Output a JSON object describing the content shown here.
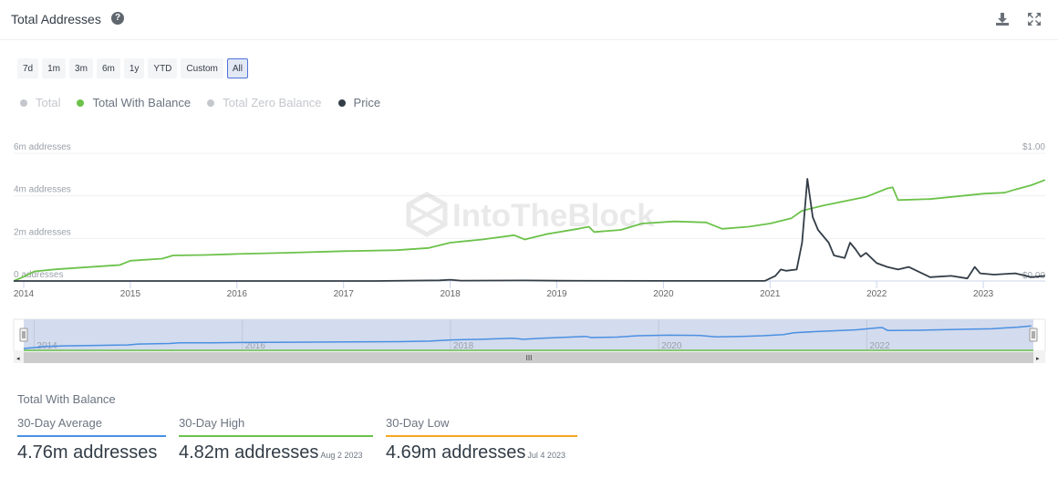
{
  "header": {
    "title": "Total Addresses",
    "help_icon": "question-circle-icon",
    "download_icon": "download-icon",
    "fullscreen_icon": "expand-icon"
  },
  "range_buttons": [
    {
      "label": "7d",
      "active": false
    },
    {
      "label": "1m",
      "active": false
    },
    {
      "label": "3m",
      "active": false
    },
    {
      "label": "6m",
      "active": false
    },
    {
      "label": "1y",
      "active": false
    },
    {
      "label": "YTD",
      "active": false
    },
    {
      "label": "Custom",
      "active": false
    },
    {
      "label": "All",
      "active": true
    }
  ],
  "legend": [
    {
      "label": "Total",
      "color": "#c4c7cc",
      "enabled": false
    },
    {
      "label": "Total With Balance",
      "color": "#6cc24a",
      "enabled": true
    },
    {
      "label": "Total Zero Balance",
      "color": "#c4c7cc",
      "enabled": false
    },
    {
      "label": "Price",
      "color": "#333d47",
      "enabled": true
    }
  ],
  "watermark": "IntoTheBlock",
  "chart_data": {
    "type": "line",
    "title": "Total Addresses",
    "xlabel": "",
    "ylabel": "addresses",
    "x_ticks": [
      "2014",
      "2015",
      "2016",
      "2017",
      "2018",
      "2019",
      "2020",
      "2021",
      "2022",
      "2023"
    ],
    "y_left_ticks": [
      "0 addresses",
      "2m addresses",
      "4m addresses",
      "6m addresses"
    ],
    "y_left_range": [
      0,
      6000000
    ],
    "y_right_ticks": [
      "$0.00",
      "$1.00"
    ],
    "y_right_range": [
      0,
      1.0
    ],
    "grid": true,
    "series": [
      {
        "name": "Total With Balance",
        "color": "#6cc24a",
        "axis": "left",
        "points": [
          [
            2013.9,
            0.0
          ],
          [
            2014.0,
            0.2
          ],
          [
            2014.1,
            0.45
          ],
          [
            2014.3,
            0.55
          ],
          [
            2014.6,
            0.65
          ],
          [
            2014.9,
            0.75
          ],
          [
            2015.0,
            0.95
          ],
          [
            2015.3,
            1.05
          ],
          [
            2015.4,
            1.2
          ],
          [
            2015.7,
            1.22
          ],
          [
            2016.0,
            1.27
          ],
          [
            2016.5,
            1.33
          ],
          [
            2017.0,
            1.4
          ],
          [
            2017.5,
            1.45
          ],
          [
            2017.8,
            1.55
          ],
          [
            2018.0,
            1.8
          ],
          [
            2018.3,
            1.95
          ],
          [
            2018.6,
            2.15
          ],
          [
            2018.7,
            1.95
          ],
          [
            2018.9,
            2.2
          ],
          [
            2019.2,
            2.45
          ],
          [
            2019.3,
            2.55
          ],
          [
            2019.35,
            2.3
          ],
          [
            2019.6,
            2.4
          ],
          [
            2019.8,
            2.7
          ],
          [
            2020.1,
            2.8
          ],
          [
            2020.4,
            2.75
          ],
          [
            2020.55,
            2.45
          ],
          [
            2020.8,
            2.55
          ],
          [
            2021.0,
            2.7
          ],
          [
            2021.2,
            2.95
          ],
          [
            2021.3,
            3.3
          ],
          [
            2021.5,
            3.55
          ],
          [
            2021.7,
            3.75
          ],
          [
            2021.9,
            3.95
          ],
          [
            2022.1,
            4.35
          ],
          [
            2022.15,
            4.4
          ],
          [
            2022.2,
            3.8
          ],
          [
            2022.5,
            3.85
          ],
          [
            2022.8,
            4.0
          ],
          [
            2023.0,
            4.1
          ],
          [
            2023.2,
            4.15
          ],
          [
            2023.3,
            4.3
          ],
          [
            2023.45,
            4.5
          ],
          [
            2023.58,
            4.75
          ]
        ]
      },
      {
        "name": "Price",
        "color": "#333d47",
        "axis": "right",
        "points": [
          [
            2013.9,
            0.0
          ],
          [
            2017.3,
            0.0
          ],
          [
            2017.9,
            0.005
          ],
          [
            2018.0,
            0.01
          ],
          [
            2018.1,
            0.003
          ],
          [
            2018.7,
            0.004
          ],
          [
            2019.0,
            0.002
          ],
          [
            2020.0,
            0.001
          ],
          [
            2020.95,
            0.001
          ],
          [
            2021.05,
            0.04
          ],
          [
            2021.1,
            0.09
          ],
          [
            2021.15,
            0.08
          ],
          [
            2021.25,
            0.09
          ],
          [
            2021.3,
            0.3
          ],
          [
            2021.35,
            0.8
          ],
          [
            2021.4,
            0.5
          ],
          [
            2021.45,
            0.4
          ],
          [
            2021.55,
            0.3
          ],
          [
            2021.6,
            0.2
          ],
          [
            2021.7,
            0.18
          ],
          [
            2021.75,
            0.3
          ],
          [
            2021.8,
            0.25
          ],
          [
            2021.85,
            0.19
          ],
          [
            2021.9,
            0.22
          ],
          [
            2022.0,
            0.14
          ],
          [
            2022.1,
            0.11
          ],
          [
            2022.2,
            0.09
          ],
          [
            2022.3,
            0.11
          ],
          [
            2022.4,
            0.07
          ],
          [
            2022.5,
            0.03
          ],
          [
            2022.7,
            0.04
          ],
          [
            2022.85,
            0.02
          ],
          [
            2022.92,
            0.11
          ],
          [
            2022.97,
            0.06
          ],
          [
            2023.1,
            0.05
          ],
          [
            2023.3,
            0.06
          ],
          [
            2023.45,
            0.03
          ],
          [
            2023.58,
            0.04
          ]
        ]
      }
    ],
    "navigator": {
      "x_ticks": [
        "2014",
        "2016",
        "2018",
        "2020",
        "2022"
      ]
    }
  },
  "stats": {
    "title": "Total With Balance",
    "items": [
      {
        "label": "30-Day Average",
        "value": "4.76m addresses",
        "date": "",
        "color": "#4a90e2"
      },
      {
        "label": "30-Day High",
        "value": "4.82m addresses",
        "date": "Aug 2 2023",
        "color": "#6cc24a"
      },
      {
        "label": "30-Day Low",
        "value": "4.69m addresses",
        "date": "Jul 4 2023",
        "color": "#f5a623"
      }
    ]
  }
}
